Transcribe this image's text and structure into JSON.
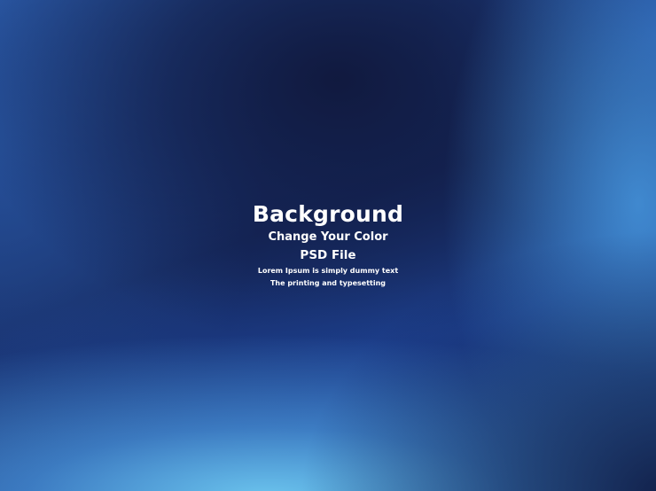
{
  "background": {
    "colors": {
      "navy_dark": "#15275c",
      "deep_blue": "#1f4596",
      "light_cyan": "#6ec8f0",
      "text": "#ffffff"
    }
  },
  "text": {
    "title": "Background",
    "subtitle": "Change Your Color",
    "file_line": "PSD File",
    "line1": "Lorem Ipsum is simply dummy text",
    "line2": "The printing and typesetting"
  }
}
